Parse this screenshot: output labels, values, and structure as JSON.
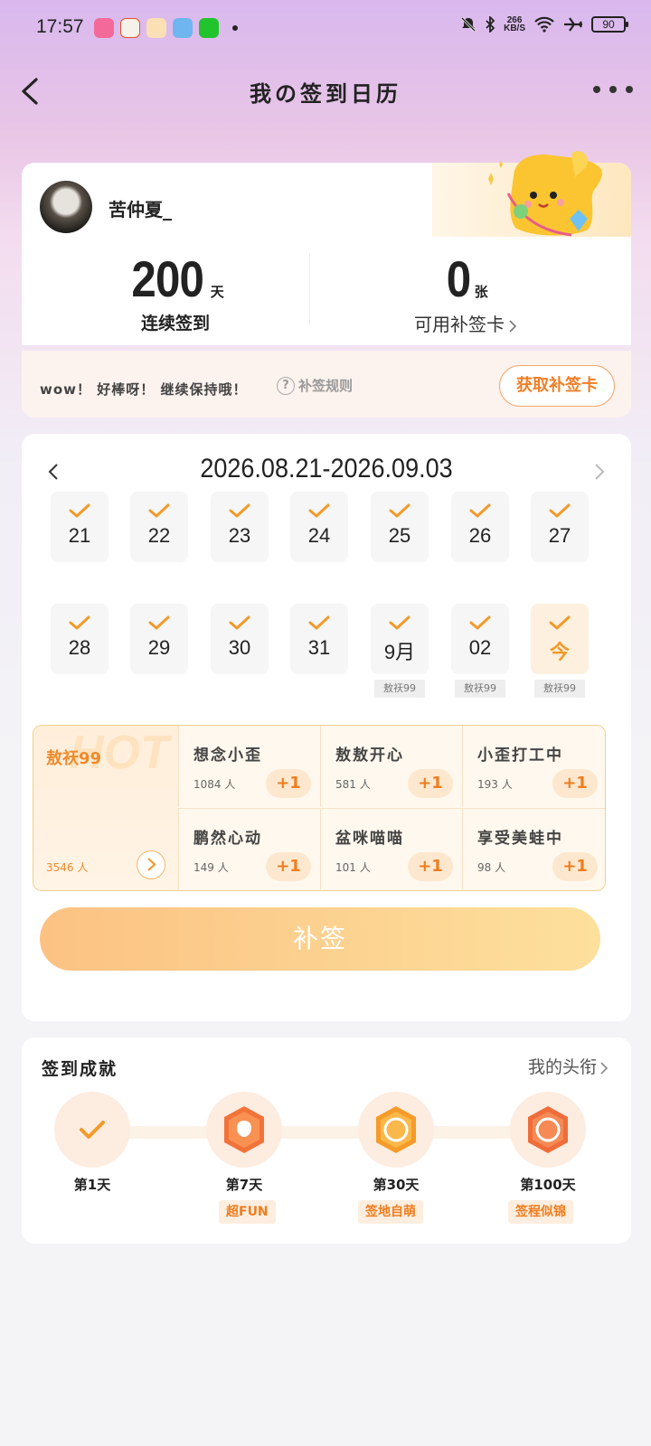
{
  "status_bar": {
    "time": "17:57",
    "net_speed_top": "266",
    "net_speed_bottom": "KB/S",
    "battery": "90"
  },
  "header": {
    "title": "我の签到日历"
  },
  "profile": {
    "username": "苦仲夏_",
    "streak_value": "200",
    "streak_unit": "天",
    "streak_label": "连续签到",
    "cards_value": "0",
    "cards_unit": "张",
    "cards_label": "可用补签卡",
    "tip": "wow！ 好棒呀！ 继续保持哦！",
    "rule_label": "补签规则",
    "get_card_button": "获取补签卡"
  },
  "calendar": {
    "range": "2026.08.21-2026.09.03",
    "days": [
      {
        "label": "21",
        "checked": true,
        "tag": ""
      },
      {
        "label": "22",
        "checked": true,
        "tag": ""
      },
      {
        "label": "23",
        "checked": true,
        "tag": ""
      },
      {
        "label": "24",
        "checked": true,
        "tag": ""
      },
      {
        "label": "25",
        "checked": true,
        "tag": ""
      },
      {
        "label": "26",
        "checked": true,
        "tag": ""
      },
      {
        "label": "27",
        "checked": true,
        "tag": ""
      },
      {
        "label": "28",
        "checked": true,
        "tag": ""
      },
      {
        "label": "29",
        "checked": true,
        "tag": ""
      },
      {
        "label": "30",
        "checked": true,
        "tag": ""
      },
      {
        "label": "31",
        "checked": true,
        "tag": ""
      },
      {
        "label": "9月",
        "checked": true,
        "tag": "敖祆99"
      },
      {
        "label": "02",
        "checked": true,
        "tag": "敖祆99"
      },
      {
        "label": "今",
        "checked": true,
        "tag": "敖祆99",
        "today": true
      }
    ]
  },
  "blessings": {
    "hot": {
      "watermark": "HOT",
      "name": "敖祆99",
      "count": "3546 人"
    },
    "items": [
      {
        "name": "想念小歪",
        "count": "1084 人",
        "plus": "+1"
      },
      {
        "name": "敖敖开心",
        "count": "581 人",
        "plus": "+1"
      },
      {
        "name": "小歪打工中",
        "count": "193 人",
        "plus": "+1"
      },
      {
        "name": "鹏然心动",
        "count": "149 人",
        "plus": "+1"
      },
      {
        "name": "盆咪喵喵",
        "count": "101 人",
        "plus": "+1"
      },
      {
        "name": "享受美蛙中",
        "count": "98 人",
        "plus": "+1"
      }
    ]
  },
  "makeup_button": "补签",
  "achievements": {
    "title": "签到成就",
    "link": "我的头衔",
    "badges": [
      {
        "label": "第1天",
        "tag": ""
      },
      {
        "label": "第7天",
        "tag": "超FUN"
      },
      {
        "label": "第30天",
        "tag": "签地自萌"
      },
      {
        "label": "第100天",
        "tag": "签程似锦"
      }
    ]
  },
  "colors": {
    "accent": "#f39a2a",
    "check": "#f39a2a",
    "button_gradient_start": "#fcc283",
    "button_gradient_end": "#fde09c"
  }
}
